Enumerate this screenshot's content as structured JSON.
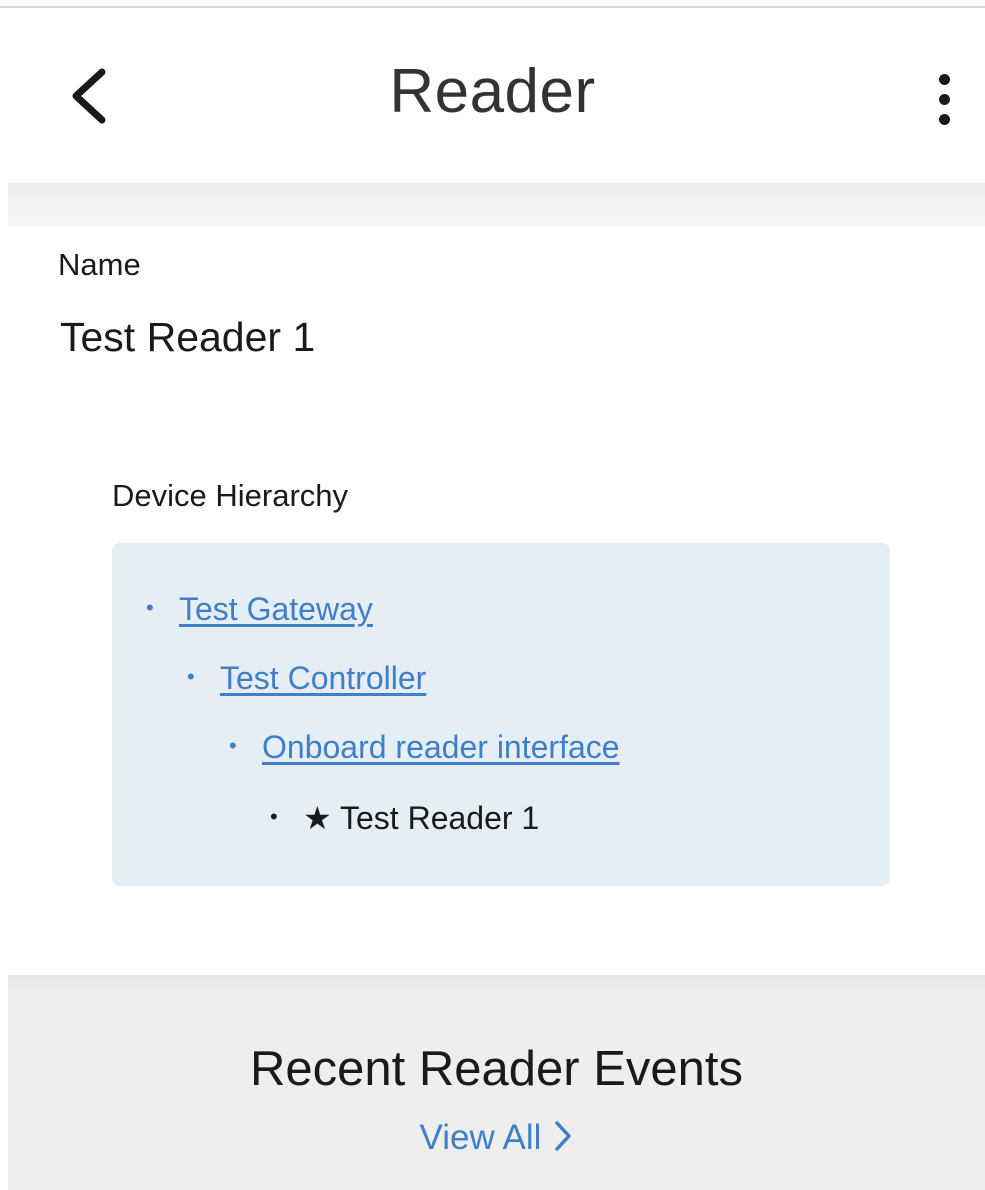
{
  "app_bar": {
    "title": "Reader",
    "back_icon": "chevron-left-icon",
    "menu_icon": "more-vertical-icon"
  },
  "details": {
    "name_label": "Name",
    "name_value": "Test Reader 1"
  },
  "hierarchy": {
    "label": "Device Hierarchy",
    "items": [
      {
        "bullet": "•",
        "label": "Test Gateway",
        "link": true
      },
      {
        "bullet": "•",
        "label": "Test Controller",
        "link": true
      },
      {
        "bullet": "•",
        "label": "Onboard reader interface",
        "link": true
      },
      {
        "bullet": "•",
        "label": "★ Test Reader 1",
        "link": false
      }
    ]
  },
  "events": {
    "title": "Recent Reader Events",
    "view_all_label": "View All",
    "view_all_icon": "chevron-right-icon"
  },
  "colors": {
    "link": "#3f7fc6",
    "hierarchy_bg": "#e5edf5",
    "events_bg": "#eeeeee",
    "text": "#1a1a1a"
  }
}
